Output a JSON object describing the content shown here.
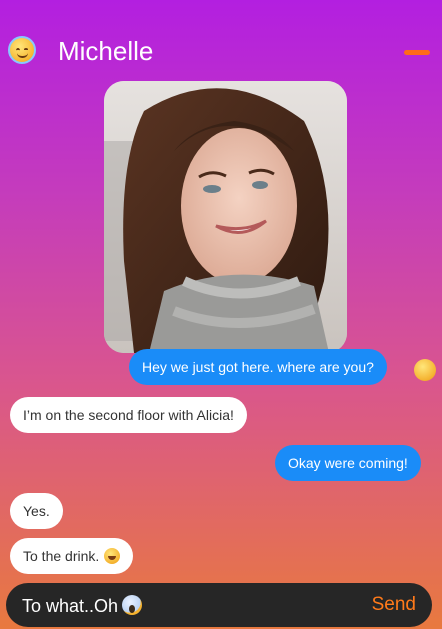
{
  "header": {
    "contact_name": "Michelle",
    "avatar_icon": "smiling-face-with-halo-icon",
    "menu_icon": "menu-dash-icon"
  },
  "photo": {
    "description_icon": "shared-photo"
  },
  "messages": [
    {
      "direction": "outgoing",
      "text": "Hey we just got here. where are you?",
      "reaction_icon": "face-with-open-mouth-icon"
    },
    {
      "direction": "incoming",
      "text": "I’m on the second floor with Alicia!"
    },
    {
      "direction": "outgoing",
      "text": "Okay were coming!"
    },
    {
      "direction": "incoming",
      "text": "Yes."
    },
    {
      "direction": "incoming",
      "text": "To the drink.",
      "emoji_icon": "grinning-squinting-face-icon"
    }
  ],
  "composer": {
    "value": "To what..Oh",
    "emoji_icon": "face-screaming-in-fear-icon",
    "send_label": "Send"
  },
  "colors": {
    "outgoing_bubble": "#1a8cf8",
    "incoming_bubble": "#ffffff",
    "accent": "#ff7a1a",
    "composer_bg": "#262626"
  }
}
